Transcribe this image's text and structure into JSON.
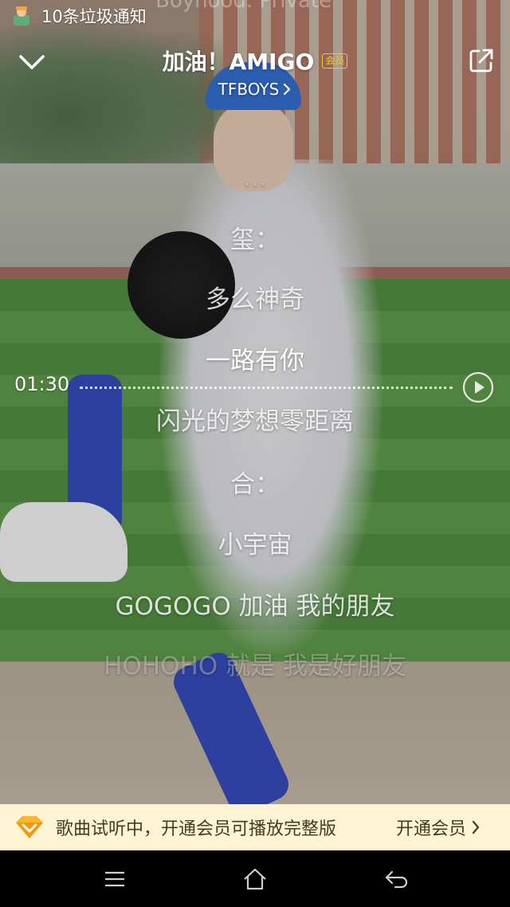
{
  "status_bar": {
    "notification_text": "10条垃圾通知",
    "background_ghost_text": "Boyhood. Private"
  },
  "header": {
    "song_title": "加油！AMIGO",
    "vip_badge": "会员",
    "artist": "TFBOYS"
  },
  "lyrics": [
    {
      "text": "...",
      "state": "faded"
    },
    {
      "text": "玺：",
      "state": "normal"
    },
    {
      "text": "多么神奇",
      "state": "normal"
    },
    {
      "text": "一路有你",
      "state": "current"
    },
    {
      "text": "闪光的梦想零距离",
      "state": "normal"
    },
    {
      "text": "合：",
      "state": "normal"
    },
    {
      "text": "小宇宙",
      "state": "normal"
    },
    {
      "text": "GOGOGO 加油 我的朋友",
      "state": "normal"
    },
    {
      "text": "HOHOHO 就是 我是好朋友",
      "state": "faded"
    }
  ],
  "seek": {
    "time": "01:30"
  },
  "trial_banner": {
    "message": "歌曲试听中，开通会员可播放完整版",
    "action": "开通会员"
  },
  "colors": {
    "vip_gold": "#f0c63c",
    "banner_bg": "#fdf3d5",
    "banner_text": "#4a3a1c"
  }
}
